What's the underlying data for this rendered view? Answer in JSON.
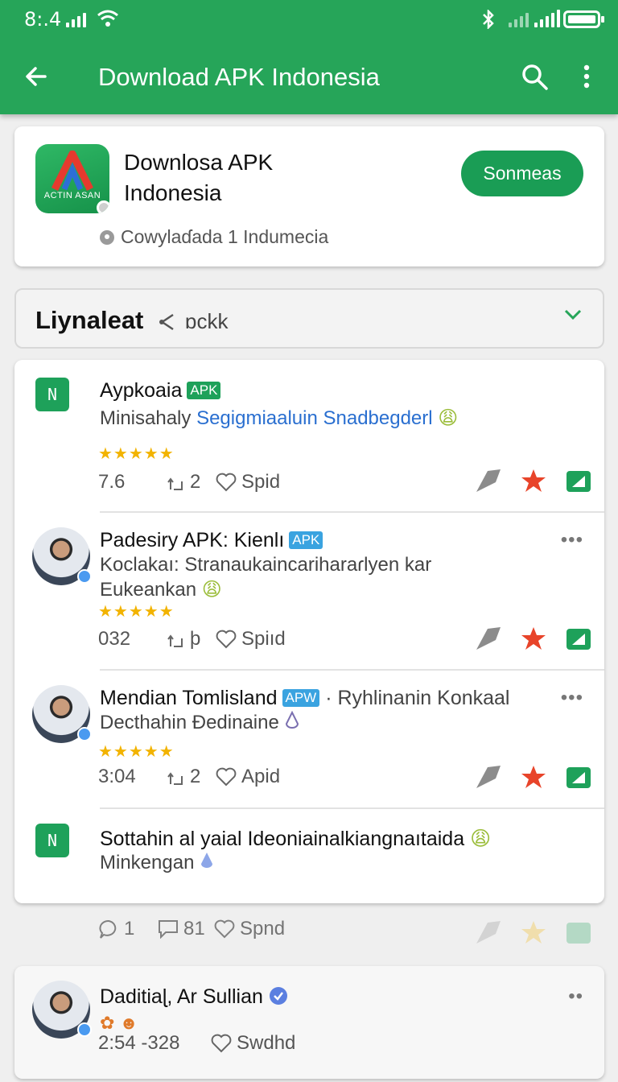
{
  "status": {
    "time": "8:.4"
  },
  "appbar": {
    "title": "Download APK Indonesia",
    "back_icon": "arrow-left-icon",
    "search_icon": "search-icon",
    "menu_icon": "more-vert-icon"
  },
  "app_card": {
    "logo_text": "ACTIN ASAN",
    "name": "Downlosa APK Indonesia",
    "button": "Sonmeas",
    "subtitle": "Cowylaɗada 1 Indumecia"
  },
  "filter": {
    "title": "Liynaleat",
    "sub": "ɒckk"
  },
  "posts": [
    {
      "icon_text": "N",
      "title": "Aypkoaia",
      "tag": "APK",
      "desc_plain": "Minisahaly",
      "desc_link": "Segigmiaaluin Snadbegderl",
      "emoji": "😩",
      "stars": "★★★★★",
      "stat1": "7.6",
      "stat2": "2",
      "stat3": "Spid"
    },
    {
      "title": "Padesiry APK: Kienlı",
      "tag": "APK",
      "desc_line1": "Koclakaı: Stranaukaincariharaɾlyen kar",
      "desc_line2": "Eukeankan",
      "emoji": "😩",
      "stars": "★★★★★",
      "stat1": "032",
      "stat2": "þ",
      "stat3": "Spiıd",
      "more": "•••"
    },
    {
      "title": "Mendian Tomlisland",
      "tag": "APW",
      "title_extra": "· Ryhlinanin Konkaal",
      "desc_line1": "Decthahin Ɖedinaine",
      "stars": "★★★★★",
      "stat1": "3:04",
      "stat2": "2",
      "stat3": "Apid",
      "more": "•••"
    },
    {
      "icon_text": "N",
      "title": "Sottahin al yaial Ideoniainalkiangnaıtaida",
      "emoji": "😩",
      "desc_line1": "Minkengan"
    }
  ],
  "stats_bar": {
    "comments": "1",
    "shares": "81",
    "likes": "Spnd"
  },
  "bottom_post": {
    "title": "Daditiaɭ, Ar Sullian",
    "stats": "2:54 -328",
    "likes": "Swdhd",
    "more": "••"
  },
  "colors": {
    "primary": "#26a559",
    "star": "#f2b300",
    "accent_red": "#e8442a",
    "link": "#2a6fd0"
  }
}
